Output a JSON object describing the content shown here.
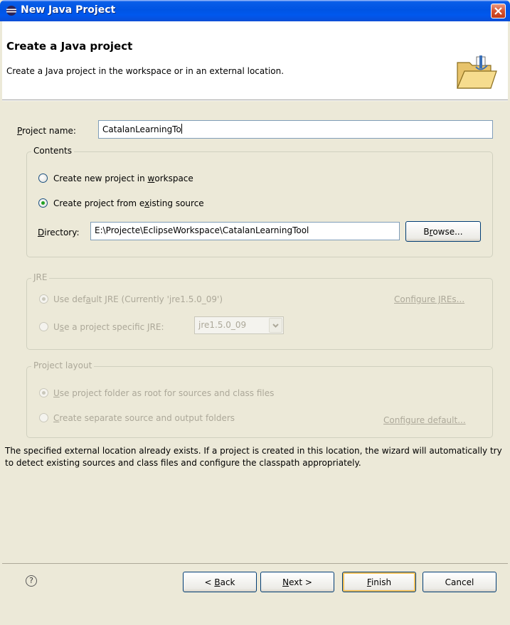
{
  "window": {
    "title": "New Java Project"
  },
  "header": {
    "title": "Create a Java project",
    "description": "Create a Java project in the workspace or in an external location."
  },
  "project": {
    "label": "Project name:",
    "value": "CatalanLearningTo"
  },
  "contents": {
    "group_title": "Contents",
    "option_new": "Create new project in workspace",
    "option_existing": "Create project from existing source",
    "selected": "existing",
    "directory_label": "Directory:",
    "directory_value": "E:\\Projecte\\EclipseWorkspace\\CatalanLearningTool",
    "browse_label": "Browse..."
  },
  "jre": {
    "group_title": "JRE",
    "option_default": "Use default JRE (Currently 'jre1.5.0_09')",
    "option_specific": "Use a project specific JRE:",
    "specific_value": "jre1.5.0_09",
    "configure_link": "Configure JREs..."
  },
  "layout": {
    "group_title": "Project layout",
    "option_root": "Use project folder as root for sources and class files",
    "option_separate": "Create separate source and output folders",
    "configure_link": "Configure default..."
  },
  "message": "The specified external location already exists. If a project is created in this location, the wizard will automatically try to detect existing sources and class files and configure the classpath appropriately.",
  "footer": {
    "help_icon": "?",
    "back_label": "< Back",
    "next_label": "Next >",
    "finish_label": "Finish",
    "cancel_label": "Cancel"
  },
  "colors": {
    "titlebar": "#0054e3",
    "dialog_bg": "#ece9d8",
    "disabled_text": "#aca899",
    "radio_check": "#21a121"
  }
}
